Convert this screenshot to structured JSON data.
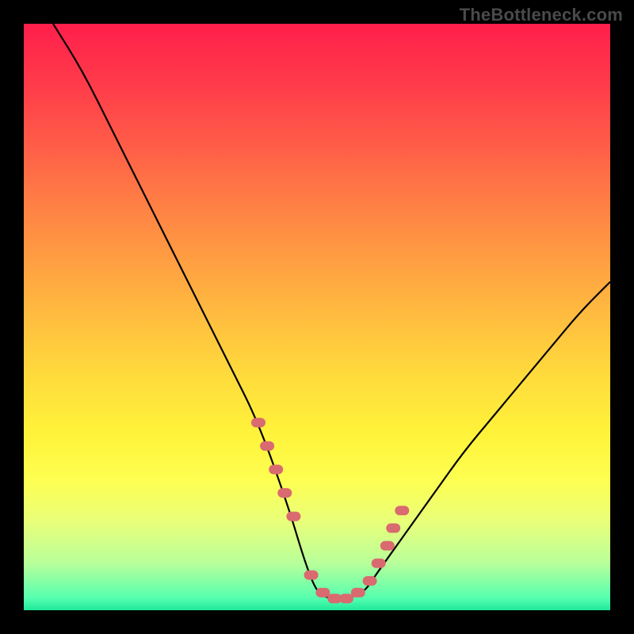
{
  "watermark": "TheBottleneck.com",
  "chart_data": {
    "type": "line",
    "title": "",
    "xlabel": "",
    "ylabel": "",
    "xlim": [
      0,
      100
    ],
    "ylim": [
      0,
      100
    ],
    "series": [
      {
        "name": "bottleneck-curve",
        "x": [
          5,
          10,
          15,
          20,
          25,
          30,
          35,
          40,
          45,
          48,
          50,
          52,
          55,
          58,
          60,
          65,
          70,
          75,
          80,
          85,
          90,
          95,
          100
        ],
        "y": [
          100,
          92,
          82,
          72,
          62,
          52,
          42,
          32,
          18,
          8,
          3,
          2,
          2,
          3,
          6,
          13,
          20,
          27,
          33,
          39,
          45,
          51,
          56
        ]
      }
    ],
    "markers": {
      "name": "highlight-points",
      "color": "#d96a6f",
      "x": [
        40,
        41.5,
        43,
        44.5,
        46,
        49,
        51,
        53,
        55,
        57,
        59,
        60.5,
        62,
        63,
        64.5
      ],
      "y": [
        32,
        28,
        24,
        20,
        16,
        6,
        3,
        2,
        2,
        3,
        5,
        8,
        11,
        14,
        17
      ]
    },
    "gradient_stops": [
      {
        "pos": 0,
        "color": "#ff1f4b"
      },
      {
        "pos": 50,
        "color": "#ffbd3f"
      },
      {
        "pos": 78,
        "color": "#fdff52"
      },
      {
        "pos": 100,
        "color": "#20e89a"
      }
    ]
  }
}
